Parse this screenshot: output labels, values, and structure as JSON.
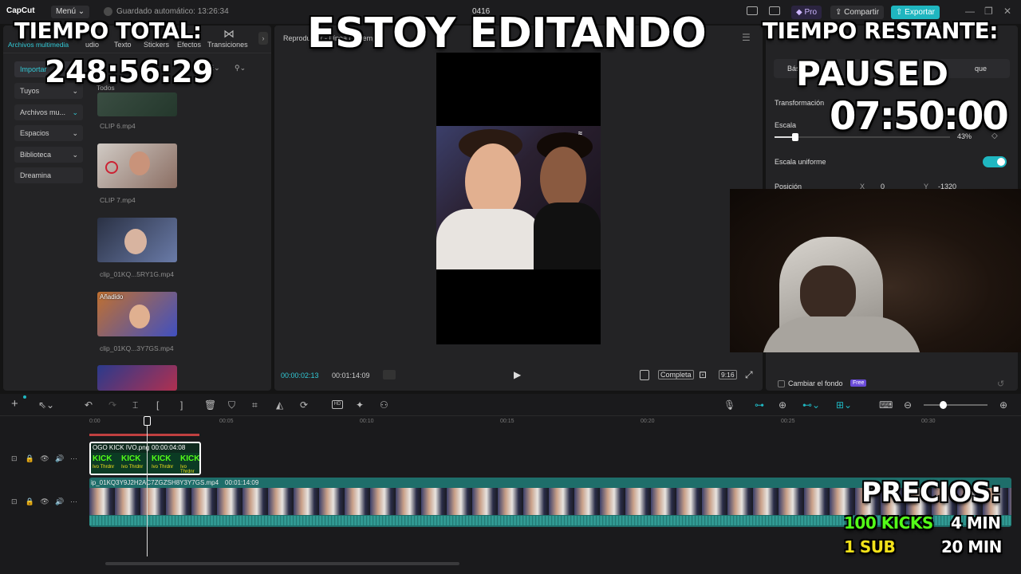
{
  "titlebar": {
    "app_name": "CapCut",
    "menu_label": "Menú",
    "autosave_text": "Guardado automático: 13:26:34",
    "project_name": "0416",
    "pro_label": "Pro",
    "share_label": "Compartir",
    "export_label": "Exportar"
  },
  "media": {
    "tabs": [
      "Archivos multimedia",
      "udio",
      "Texto",
      "Stickers",
      "Efectos",
      "Transiciones"
    ],
    "sidebar": [
      "Importar",
      "Tuyos",
      "Archivos mu...",
      "Espacios",
      "Biblioteca",
      "Dreamina"
    ],
    "filter_all": "Todos",
    "clips": [
      {
        "name": "CLIP 6.mp4",
        "badge": ""
      },
      {
        "name": "CLIP 7.mp4",
        "badge": ""
      },
      {
        "name": "clip_01KQ...5RY1G.mp4",
        "badge": ""
      },
      {
        "name": "clip_01KQ...3Y7GS.mp4",
        "badge": "Añadido"
      }
    ]
  },
  "player": {
    "title": "Reproductor - Línea de tiempo",
    "current_time": "00:00:02:13",
    "total_time": "00:01:14:09",
    "full_label": "Completa",
    "ratio_label": "9:16"
  },
  "details": {
    "tab_basic": "Bás",
    "tab_remove": "que",
    "transform_label": "Transformación",
    "scale_label": "Escala",
    "scale_value": "43%",
    "scale_fraction": 0.12,
    "uniform_label": "Escala uniforme",
    "uniform_on": true,
    "position_label": "Posición",
    "pos_x_label": "X",
    "pos_x": "0",
    "pos_y_label": "Y",
    "pos_y": "-1320",
    "bg_label": "Cambiar el fondo",
    "free_badge": "Free"
  },
  "timeline": {
    "ruler": [
      "0:00",
      "00:05",
      "00:10",
      "00:15",
      "00:20",
      "00:25",
      "00:30"
    ],
    "clip1_name": "OGO KICK IVO.png",
    "clip1_dur": "00:00:04:08",
    "clip2_name": "ip_01KQ3Y9J2H2AC7ZGZSH8Y3Y7GS.mp4",
    "clip2_dur": "00:01:14:09",
    "kick_word": "KICK",
    "kick_sub": "Ivo Thrdnr"
  },
  "overlay": {
    "editing": "ESTOY EDITANDO",
    "total_label": "TIEMPO TOTAL:",
    "total_value": "248:56:29",
    "remaining_label": "TIEMPO RESTANTE:",
    "paused": "PAUSED",
    "remaining_value": "07:50:00",
    "prices_label": "PRECIOS:",
    "price1_item": "100 KICKS",
    "price1_value": "4 MIN",
    "price2_item": "1 SUB",
    "price2_value": "20 MIN"
  },
  "colors": {
    "accent": "#1fb6c0",
    "kick_green": "#53fc18",
    "sub_yellow": "#f2e21a"
  }
}
